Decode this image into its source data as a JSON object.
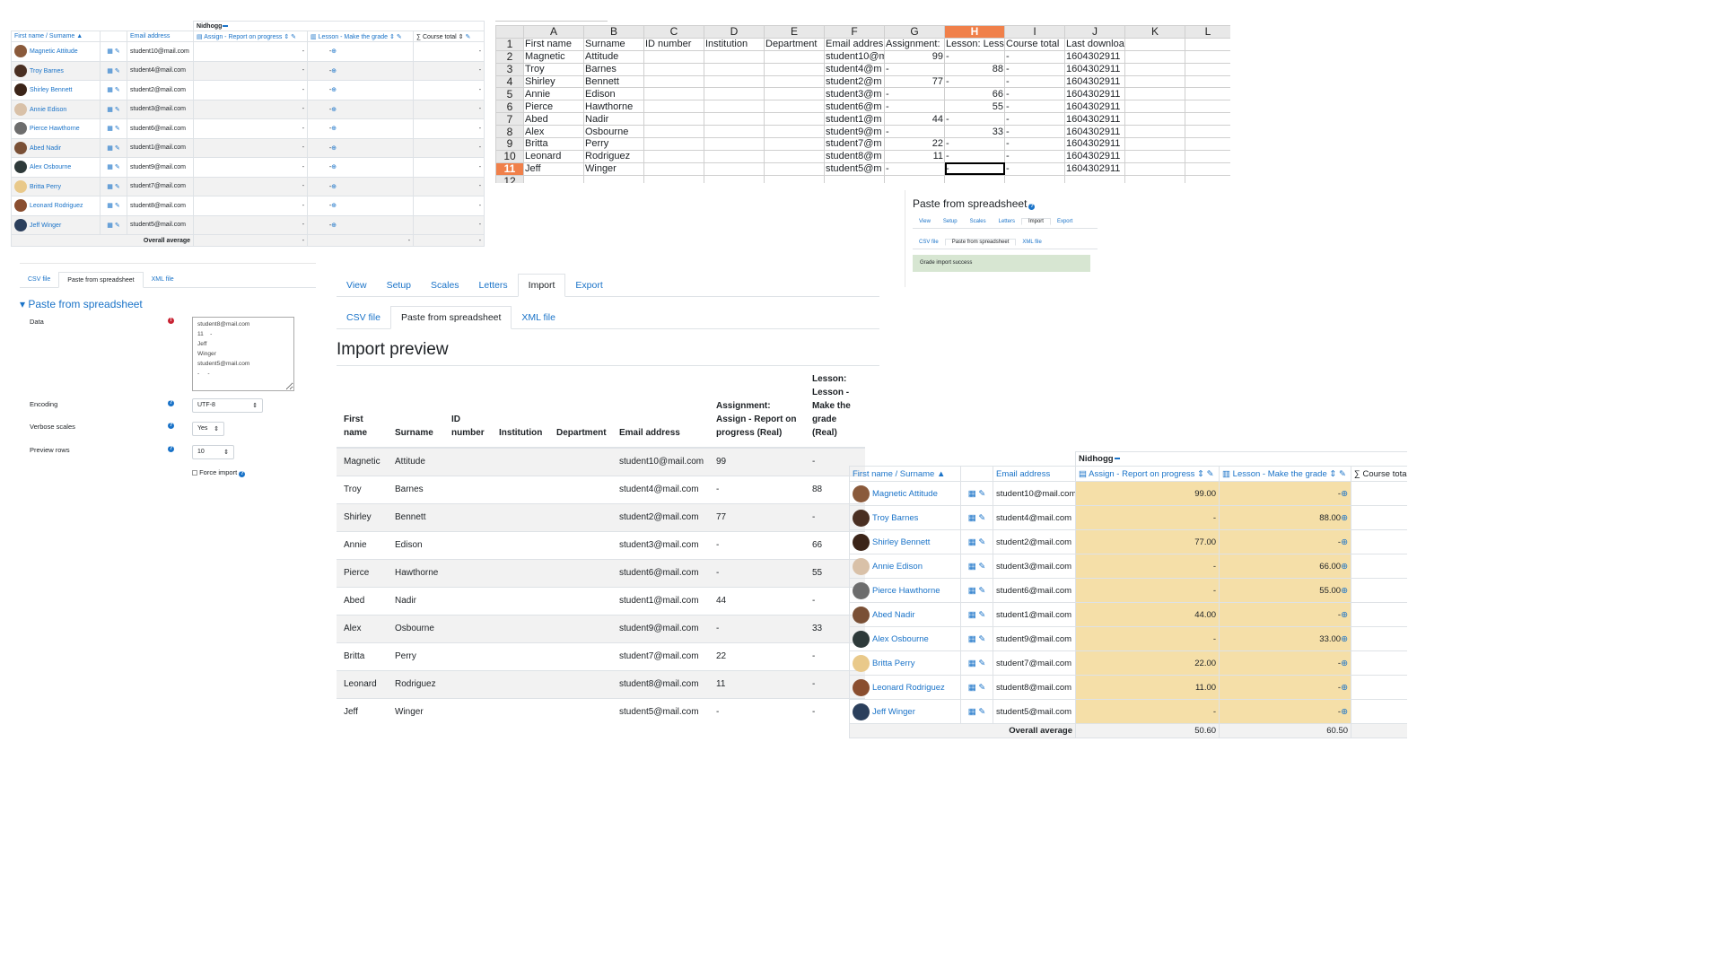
{
  "students": [
    {
      "first": "Magnetic",
      "surname": "Attitude",
      "full": "Magnetic Attitude",
      "email": "student10@mail.com",
      "assign": "99",
      "lesson": "-",
      "assign_f": "99.00",
      "lesson_f": "-",
      "ss_id": "2",
      "ss_email": "student10@m",
      "avatar": "#8a5a3b"
    },
    {
      "first": "Troy",
      "surname": "Barnes",
      "full": "Troy Barnes",
      "email": "student4@mail.com",
      "assign": "-",
      "lesson": "88",
      "assign_f": "-",
      "lesson_f": "88.00",
      "ss_id": "3",
      "ss_email": "student4@m",
      "avatar": "#4a2f22"
    },
    {
      "first": "Shirley",
      "surname": "Bennett",
      "full": "Shirley Bennett",
      "email": "student2@mail.com",
      "assign": "77",
      "lesson": "-",
      "assign_f": "77.00",
      "lesson_f": "-",
      "ss_id": "4",
      "ss_email": "student2@m",
      "avatar": "#3b2418"
    },
    {
      "first": "Annie",
      "surname": "Edison",
      "full": "Annie Edison",
      "email": "student3@mail.com",
      "assign": "-",
      "lesson": "66",
      "assign_f": "-",
      "lesson_f": "66.00",
      "ss_id": "5",
      "ss_email": "student3@m",
      "avatar": "#d9c1a8"
    },
    {
      "first": "Pierce",
      "surname": "Hawthorne",
      "full": "Pierce Hawthorne",
      "email": "student6@mail.com",
      "assign": "-",
      "lesson": "55",
      "assign_f": "-",
      "lesson_f": "55.00",
      "ss_id": "6",
      "ss_email": "student6@m",
      "avatar": "#6d6d6d"
    },
    {
      "first": "Abed",
      "surname": "Nadir",
      "full": "Abed Nadir",
      "email": "student1@mail.com",
      "assign": "44",
      "lesson": "-",
      "assign_f": "44.00",
      "lesson_f": "-",
      "ss_id": "7",
      "ss_email": "student1@m",
      "avatar": "#7a5036"
    },
    {
      "first": "Alex",
      "surname": "Osbourne",
      "full": "Alex Osbourne",
      "email": "student9@mail.com",
      "assign": "-",
      "lesson": "33",
      "assign_f": "-",
      "lesson_f": "33.00",
      "ss_id": "8",
      "ss_email": "student9@m",
      "avatar": "#2e3a3a"
    },
    {
      "first": "Britta",
      "surname": "Perry",
      "full": "Britta Perry",
      "email": "student7@mail.com",
      "assign": "22",
      "lesson": "-",
      "assign_f": "22.00",
      "lesson_f": "-",
      "ss_id": "9",
      "ss_email": "student7@m",
      "avatar": "#e9c98a"
    },
    {
      "first": "Leonard",
      "surname": "Rodriguez",
      "full": "Leonard Rodriguez",
      "email": "student8@mail.com",
      "assign": "11",
      "lesson": "-",
      "assign_f": "11.00",
      "lesson_f": "-",
      "ss_id": "10",
      "ss_email": "student8@m",
      "avatar": "#8a4e2f"
    },
    {
      "first": "Jeff",
      "surname": "Winger",
      "full": "Jeff Winger",
      "email": "student5@mail.com",
      "assign": "-",
      "lesson": "-",
      "assign_f": "-",
      "lesson_f": "-",
      "ss_id": "11",
      "ss_email": "student5@m",
      "avatar": "#2b3f5c"
    }
  ],
  "grader": {
    "category": "Nidhogg",
    "col_name": "First name / Surname",
    "col_email": "Email address",
    "col_assign": "Assign - Report on progress",
    "col_lesson": "Lesson - Make the grade",
    "col_total": "Course total",
    "col_total_cut": "Course tota",
    "overall": "Overall average",
    "dash": "-",
    "avg_assign": "50.60",
    "avg_lesson": "60.50"
  },
  "spreadsheet": {
    "columns": [
      "A",
      "B",
      "C",
      "D",
      "E",
      "F",
      "G",
      "H",
      "I",
      "J",
      "K",
      "L"
    ],
    "header": [
      "First name",
      "Surname",
      "ID number",
      "Institution",
      "Department",
      "Email addres",
      "Assignment:",
      "Lesson: Less",
      "Course total",
      "Last downloaded from this course",
      "",
      ""
    ],
    "header_row": "1",
    "last_row": "12",
    "timestamp": "1604302911",
    "dash": "-"
  },
  "tabs": {
    "main": [
      "View",
      "Setup",
      "Scales",
      "Letters",
      "Import",
      "Export"
    ],
    "sub": [
      "CSV file",
      "Paste from spreadsheet",
      "XML file"
    ]
  },
  "form": {
    "legend": "Paste from spreadsheet",
    "data_label": "Data",
    "data_value": "student8@mail.com\n11    -\nJeff\nWinger\nstudent5@mail.com\n-     -",
    "encoding_label": "Encoding",
    "encoding_value": "UTF-8",
    "verbose_label": "Verbose scales",
    "verbose_value": "Yes",
    "preview_label": "Preview rows",
    "preview_value": "10",
    "force_label": "Force import"
  },
  "success": {
    "title": "Paste from spreadsheet",
    "message": "Grade import success"
  },
  "preview": {
    "title": "Import preview",
    "headers": [
      "First name",
      "Surname",
      "ID number",
      "Institution",
      "Department",
      "Email address",
      "Assignment: Assign - Report on progress (Real)",
      "Lesson: Lesson - Make the grade (Real)"
    ]
  },
  "colors": {
    "link": "#1a73c8",
    "highlight": "#f5dfa8",
    "selected_header": "#f0804a",
    "success_bg": "#d7e6d2"
  }
}
